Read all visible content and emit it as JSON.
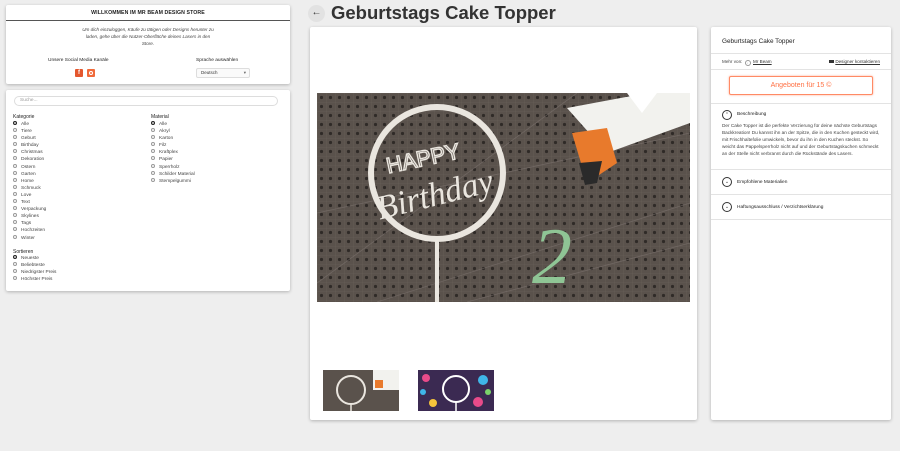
{
  "welcome": {
    "title": "WILLKOMMEN IM MR BEAM DESIGN STORE",
    "text": "Um dich einzuloggen, Käufe zu tätigen oder Designs herunter zu laden, gehe über die Nutzer-Oberfläche deines Lasers in den Store.",
    "social_label": "Unsere Social Media Kanäle",
    "language_label": "Sprache auswählen",
    "language_value": "Deutsch",
    "social_icons": [
      "facebook-icon",
      "instagram-icon"
    ]
  },
  "filters": {
    "search_placeholder": "Suche...",
    "category_title": "Kategorie",
    "categories": [
      "Alle",
      "Tiere",
      "Geburt",
      "Birthday",
      "Christmas",
      "Dekoration",
      "Ostern",
      "Garten",
      "Home",
      "Schmuck",
      "Love",
      "Text",
      "Verpackung",
      "Skylines",
      "Tags",
      "Hochzeiten",
      "Winter"
    ],
    "category_selected": "Alle",
    "material_title": "Material",
    "materials": [
      "Alle",
      "Akryl",
      "Karton",
      "Filz",
      "Kraftplex",
      "Papier",
      "Sperrholz",
      "Schilder Material",
      "Stempelgummi"
    ],
    "material_selected": "Alle",
    "sort_title": "Sortieren",
    "sort_options": [
      "Neueste",
      "Beliebteste",
      "Niedrigster Preis",
      "Höchster Preis"
    ],
    "sort_selected": "Neueste"
  },
  "page": {
    "back_icon": "arrow-left-icon",
    "title": "Geburtstags Cake Topper"
  },
  "product": {
    "title": "Geburtstags Cake Topper",
    "more_by_label": "Mehr von:",
    "designer_name": "Mr Beam",
    "contact_label": "Designer kontaktieren",
    "offer_button": "Angeboten für 15 ©",
    "sections": [
      {
        "label": "Beschreibung",
        "icon": "chevron-up-icon"
      },
      {
        "label": "Empfohlene Materialien",
        "icon": "chevron-down-icon"
      },
      {
        "label": "Haftungsausschluss / Verzichtserklärung",
        "icon": "chevron-down-icon"
      }
    ],
    "description": "Der Cake Topper ist die perfekte Verzierung für deine nächste Geburtstags Backkreation! Du kannst ihn an der Spitze, die in den Kuchen gesteckt wird, mit Frischhaltefolie umwickeln, bevor du ihn in den Kuchen steckst. So weicht das Pappelsperrholz nicht auf und der Geburtstagskuchen schmeckt an der Stelle nicht verbrannt durch die Rückstände des Lasers.",
    "image_text": [
      "HAPPY",
      "Birthday",
      "2"
    ]
  },
  "colors": {
    "accent": "#ff7043",
    "background": "#eeeeee",
    "card": "#ffffff"
  }
}
